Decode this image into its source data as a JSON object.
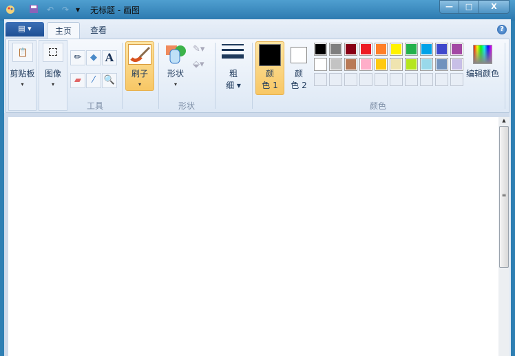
{
  "window": {
    "title": "无标题 - 画图",
    "minimize": "—",
    "maximize": "□",
    "close": "X"
  },
  "quick_access": {
    "app_icon": "paint-icon",
    "save": "save-icon",
    "undo": "undo-icon",
    "redo": "redo-icon",
    "customize": "▾"
  },
  "tabs": [
    {
      "label": "主页",
      "active": true
    },
    {
      "label": "查看",
      "active": false
    }
  ],
  "app_menu": "▤ ▾",
  "help": "?",
  "groups": {
    "clipboard": {
      "label": "剪贴板",
      "arrow": "▾"
    },
    "image": {
      "label": "图像",
      "arrow": "▾"
    },
    "tools": {
      "label": "工具",
      "text_tool": "A"
    },
    "brush": {
      "label": "刷子",
      "arrow": "▾"
    },
    "shapes": {
      "label": "形状",
      "button": "形状",
      "arrow": "▾"
    },
    "size": {
      "label_line1": "粗",
      "label_line2": "细 ▾"
    },
    "colors": {
      "label": "颜色",
      "color1_line1": "颜",
      "color1_line2": "色 1",
      "color2_line1": "颜",
      "color2_line2": "色 2",
      "edit": "编辑颜色",
      "color1": "#000000",
      "color2": "#ffffff",
      "palette": [
        [
          "#000000",
          "#7f7f7f",
          "#880015",
          "#ed1c24",
          "#ff7f27",
          "#fff200",
          "#22b14c",
          "#00a2e8",
          "#3f48cc",
          "#a349a4"
        ],
        [
          "#ffffff",
          "#c3c3c3",
          "#b97a57",
          "#ffaec9",
          "#ffc90e",
          "#efe4b0",
          "#b5e61d",
          "#99d9ea",
          "#7092be",
          "#c8bfe7"
        ],
        [
          "",
          "",
          "",
          "",
          "",
          "",
          "",
          "",
          "",
          ""
        ]
      ]
    }
  },
  "scrollbar": {
    "up": "▲",
    "grip": "≡"
  }
}
